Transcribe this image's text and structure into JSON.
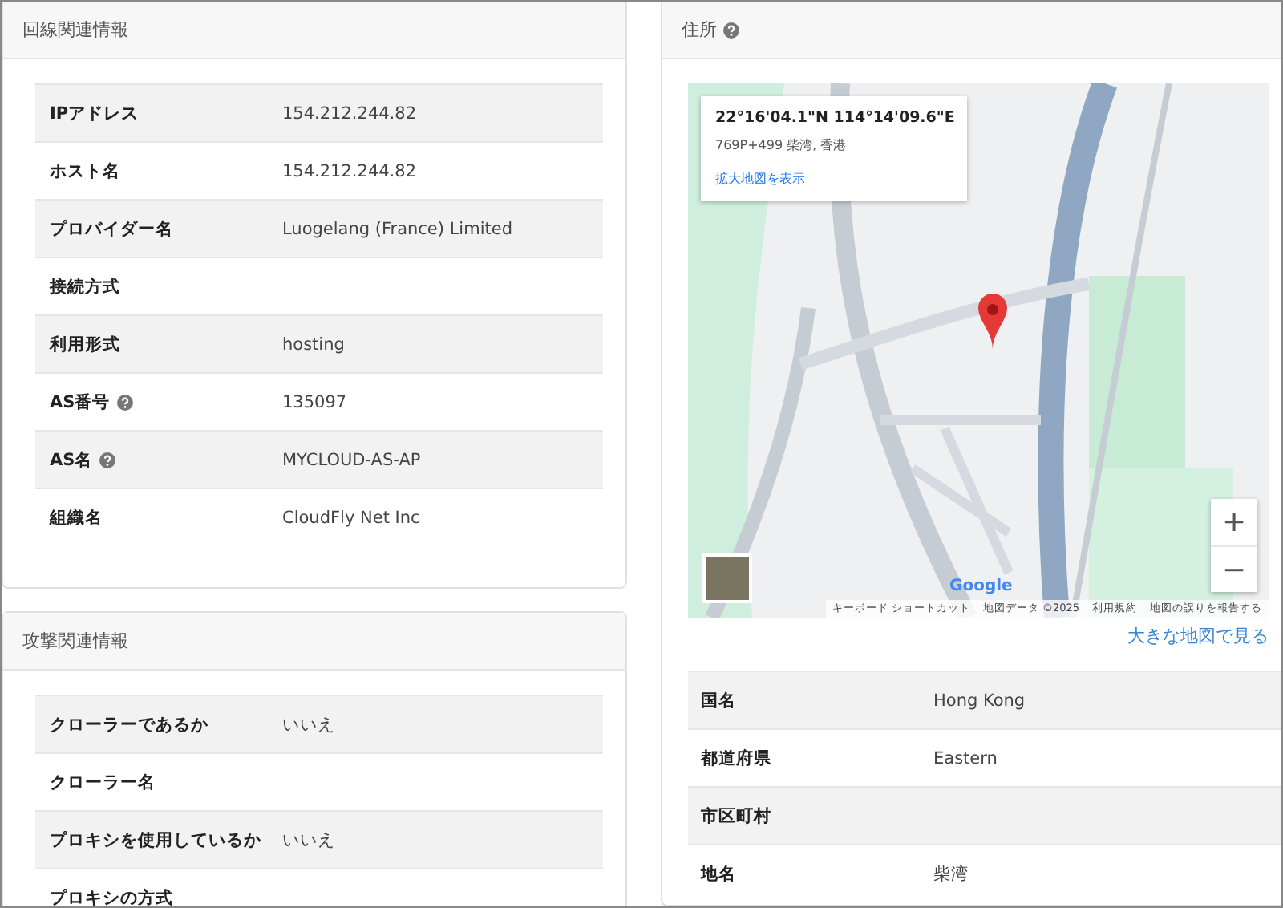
{
  "left_panels": [
    {
      "title": "回線関連情報",
      "rows": [
        {
          "label": "IPアドレス",
          "help": false,
          "value": "154.212.244.82"
        },
        {
          "label": "ホスト名",
          "help": false,
          "value": "154.212.244.82"
        },
        {
          "label": "プロバイダー名",
          "help": false,
          "value": "Luogelang (France) Limited"
        },
        {
          "label": "接続方式",
          "help": false
        },
        {
          "label": "利用形式",
          "help": false,
          "value": "hosting"
        },
        {
          "label": "AS番号",
          "help": true,
          "value": "135097"
        },
        {
          "label": "AS名",
          "help": true,
          "value": "MYCLOUD-AS-AP"
        },
        {
          "label": "組織名",
          "help": false,
          "value": "CloudFly Net Inc"
        }
      ]
    },
    {
      "title": "攻撃関連情報",
      "rows": [
        {
          "label": "クローラーであるか",
          "help": false,
          "value": "いいえ"
        },
        {
          "label": "クローラー名",
          "help": false
        },
        {
          "label": "プロキシを使用しているか",
          "help": false,
          "value": "いいえ"
        },
        {
          "label": "プロキシの方式",
          "help": false
        }
      ]
    }
  ],
  "address": {
    "title": "住所",
    "help": true,
    "map": {
      "coords": "22°16'04.1\"N 114°14'09.6\"E",
      "plus_code": "769P+499 柴湾, 香港",
      "enlarge_link": "拡大地図を表示",
      "zoom_in": "+",
      "zoom_out": "−",
      "logo": "Google",
      "attribution": [
        "キーボード ショートカット",
        "地図データ ©2025",
        "利用規約",
        "地図の誤りを報告する"
      ]
    },
    "big_map_link": "大きな地図で見る",
    "rows": [
      {
        "label": "国名",
        "value": "Hong Kong"
      },
      {
        "label": "都道府県",
        "value": "Eastern"
      },
      {
        "label": "市区町村"
      },
      {
        "label": "地名",
        "value": "柴湾"
      }
    ]
  }
}
